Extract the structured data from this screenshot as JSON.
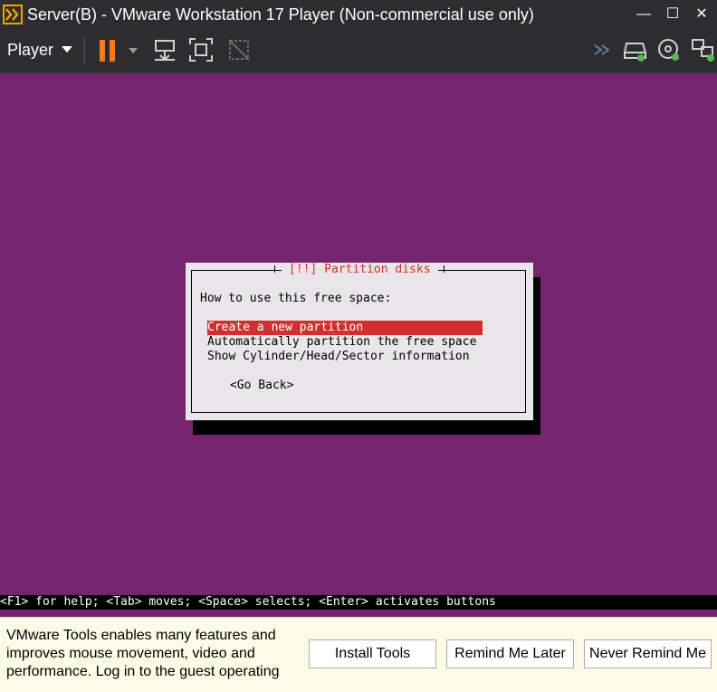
{
  "window": {
    "title": "Server(B) - VMware Workstation 17 Player (Non-commercial use only)",
    "minimize": "—",
    "maximize": "☐",
    "close": "✕"
  },
  "toolbar": {
    "player_label": "Player",
    "accent": "#f47920"
  },
  "installer": {
    "background": "#75246f",
    "dialog_title": "[!!] Partition disks",
    "prompt": "How to use this free space:",
    "options": [
      "Create a new partition",
      "Automatically partition the free space",
      "Show Cylinder/Head/Sector information"
    ],
    "selected_index": 0,
    "go_back": "<Go Back>",
    "help_line": "<F1> for help; <Tab> moves; <Space> selects; <Enter> activates buttons"
  },
  "notification": {
    "message": "VMware Tools enables many features and improves mouse movement, video and performance. Log in to the guest operating",
    "install_button": "Install Tools",
    "remind_button": "Remind Me Later",
    "never_button": "Never Remind Me"
  }
}
